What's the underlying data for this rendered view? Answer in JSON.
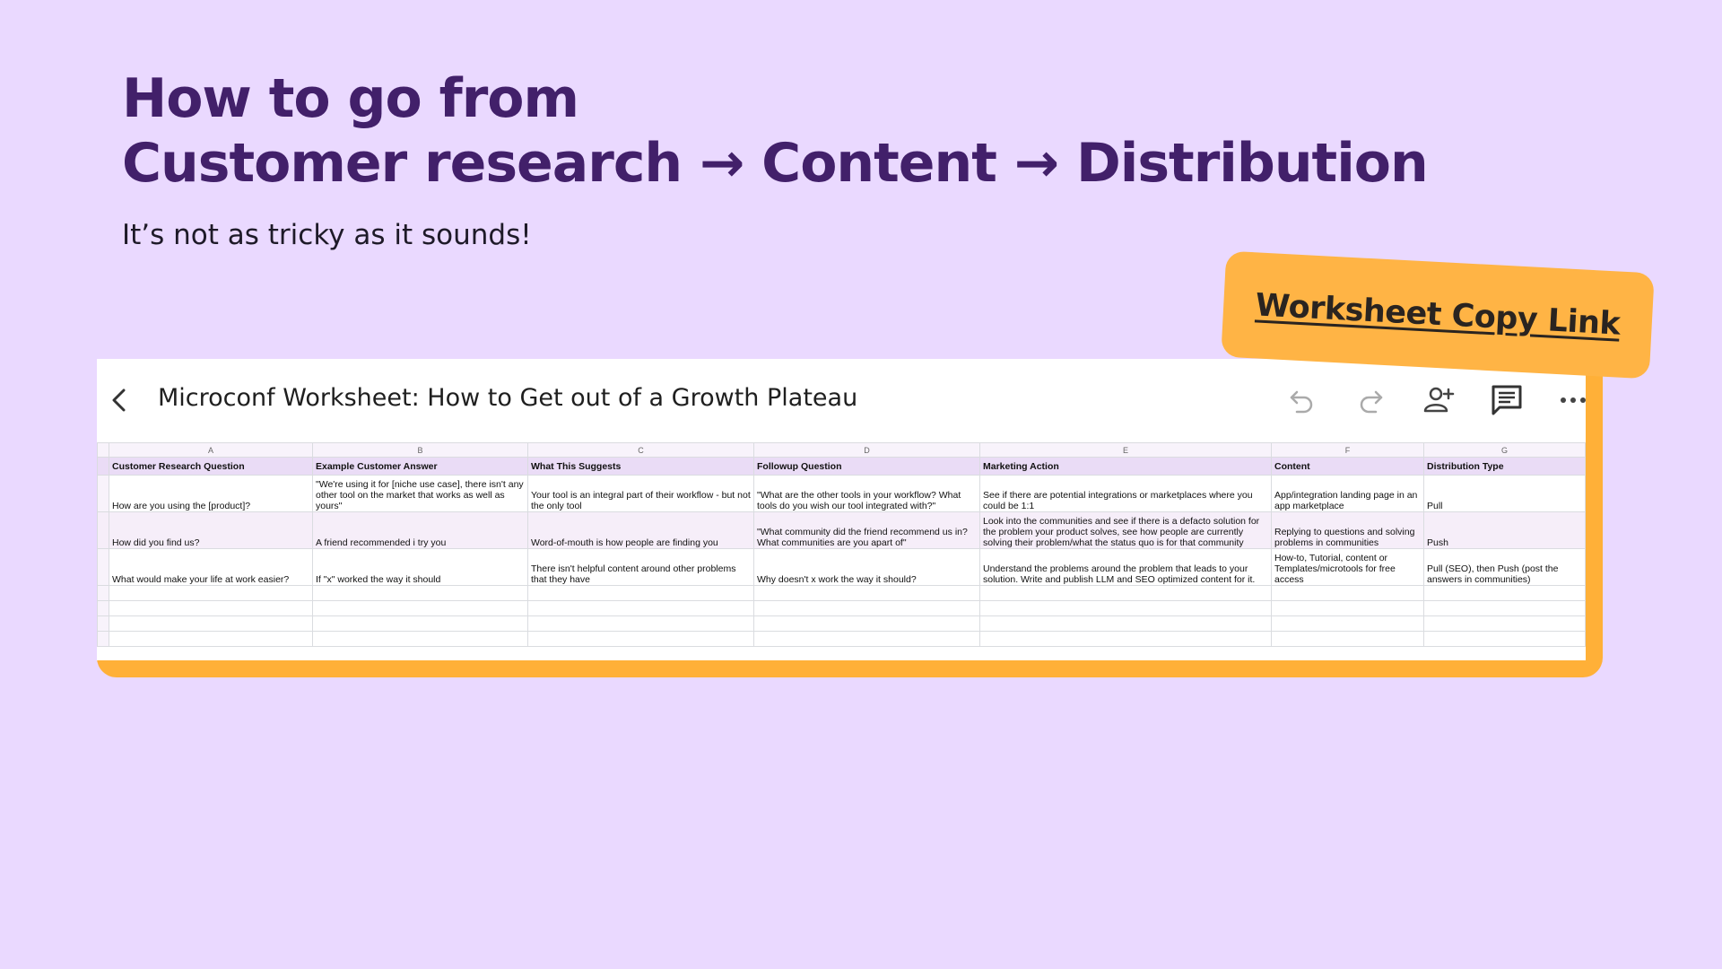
{
  "headline": {
    "line1": "How to go from",
    "line2": "Customer research → Content → Distribution"
  },
  "subtitle": "It’s not as tricky as it sounds!",
  "sticker": {
    "label": "Worksheet Copy Link"
  },
  "sheet": {
    "title": "Microconf Worksheet: How to Get out of a Growth Plateau",
    "toolbar_icons": [
      "back-icon",
      "undo-icon",
      "redo-icon",
      "add-person-icon",
      "comment-icon",
      "more-icon"
    ],
    "column_letters": [
      "A",
      "B",
      "C",
      "D",
      "E",
      "F",
      "G"
    ],
    "headers": [
      "Customer Research Question",
      "Example Customer Answer",
      "What This Suggests",
      "Followup Question",
      "Marketing Action",
      "Content",
      "Distribution Type"
    ],
    "rows": [
      [
        "How are you using the [product]?",
        "\"We're using it for [niche use case], there isn't any other tool on the market that works as well as yours\"",
        "Your tool is an integral part of their workflow - but not the only tool",
        "\"What are the other tools in your workflow? What tools do you wish our tool integrated with?\"",
        "See if there are potential integrations or marketplaces where you could  be 1:1",
        "App/integration landing page in an app marketplace",
        "Pull"
      ],
      [
        "How did you find us?",
        "A friend recommended i try you",
        "Word-of-mouth is how people are finding you",
        "\"What community did the friend recommend us in? What communities are you apart of\"",
        "Look into the communities and see if there is a defacto solution for the problem your product solves, see how people are currently solving their problem/what the status quo is for that community",
        "Replying to questions and solving problems in communities",
        "Push"
      ],
      [
        "What would make your life at work easier?",
        "If \"x\" worked the way it should",
        "There isn't helpful content around other problems that they have",
        "Why doesn't x work the way it should?",
        "Understand the problems around the problem that leads to your solution. Write and publish LLM and SEO optimized content for it.",
        "How-to, Tutorial, content or Templates/microtools for free access",
        "Pull (SEO), then Push (post the answers in communities)"
      ]
    ]
  },
  "colors": {
    "background": "#ead9ff",
    "headline": "#42206a",
    "accent": "#ffb038"
  }
}
